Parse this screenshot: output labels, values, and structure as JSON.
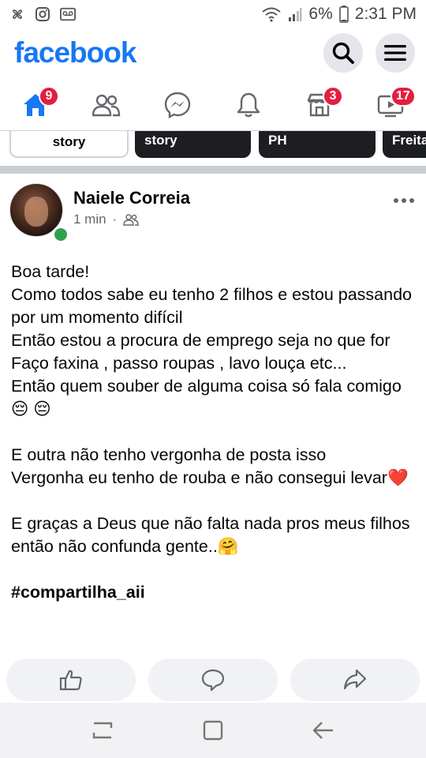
{
  "status_bar": {
    "battery_percent": "6%",
    "time": "2:31 PM",
    "left_icons": [
      "fan-icon",
      "instagram-icon",
      "voicemail-icon"
    ],
    "right_icons": [
      "wifi-icon",
      "signal-icon",
      "battery-icon"
    ]
  },
  "header": {
    "logo": "facebook",
    "brand_color": "#1877f2",
    "buttons": [
      "search-icon",
      "menu-icon"
    ]
  },
  "nav": {
    "tabs": [
      {
        "icon": "home-icon",
        "badge": "9",
        "active": true
      },
      {
        "icon": "friends-icon",
        "badge": ""
      },
      {
        "icon": "messenger-icon",
        "badge": ""
      },
      {
        "icon": "bell-icon",
        "badge": ""
      },
      {
        "icon": "marketplace-icon",
        "badge": "3"
      },
      {
        "icon": "watch-icon",
        "badge": "17"
      }
    ],
    "badge_color": "#e41e3f"
  },
  "stories": [
    {
      "label": "story"
    },
    {
      "label": "story"
    },
    {
      "label": "PH"
    },
    {
      "label": "Freita"
    }
  ],
  "post": {
    "author": "Naiele Correia",
    "time": "1 min",
    "audience_icon": "friends-icon",
    "online_color": "#31a24c",
    "lines": [
      "Boa tarde!",
      "Como todos sabe eu tenho 2 filhos e estou passando por um momento difícil",
      "Então estou a procura de emprego seja no que for",
      "Faço faxina , passo roupas , lavo louça etc...",
      "Então quem souber de alguma coisa só fala comigo😔 😔",
      "",
      "E outra não tenho vergonha de posta isso",
      "Vergonha eu tenho de rouba e não consegui levar❤️",
      "",
      "E graças a Deus que não falta nada pros meus filhos então não confunda gente..🤗"
    ],
    "hashtag": "#compartilha_aii",
    "actions": [
      "like-icon",
      "comment-icon",
      "share-icon"
    ]
  },
  "system_nav": [
    "recents-icon",
    "home-button-icon",
    "back-icon"
  ]
}
